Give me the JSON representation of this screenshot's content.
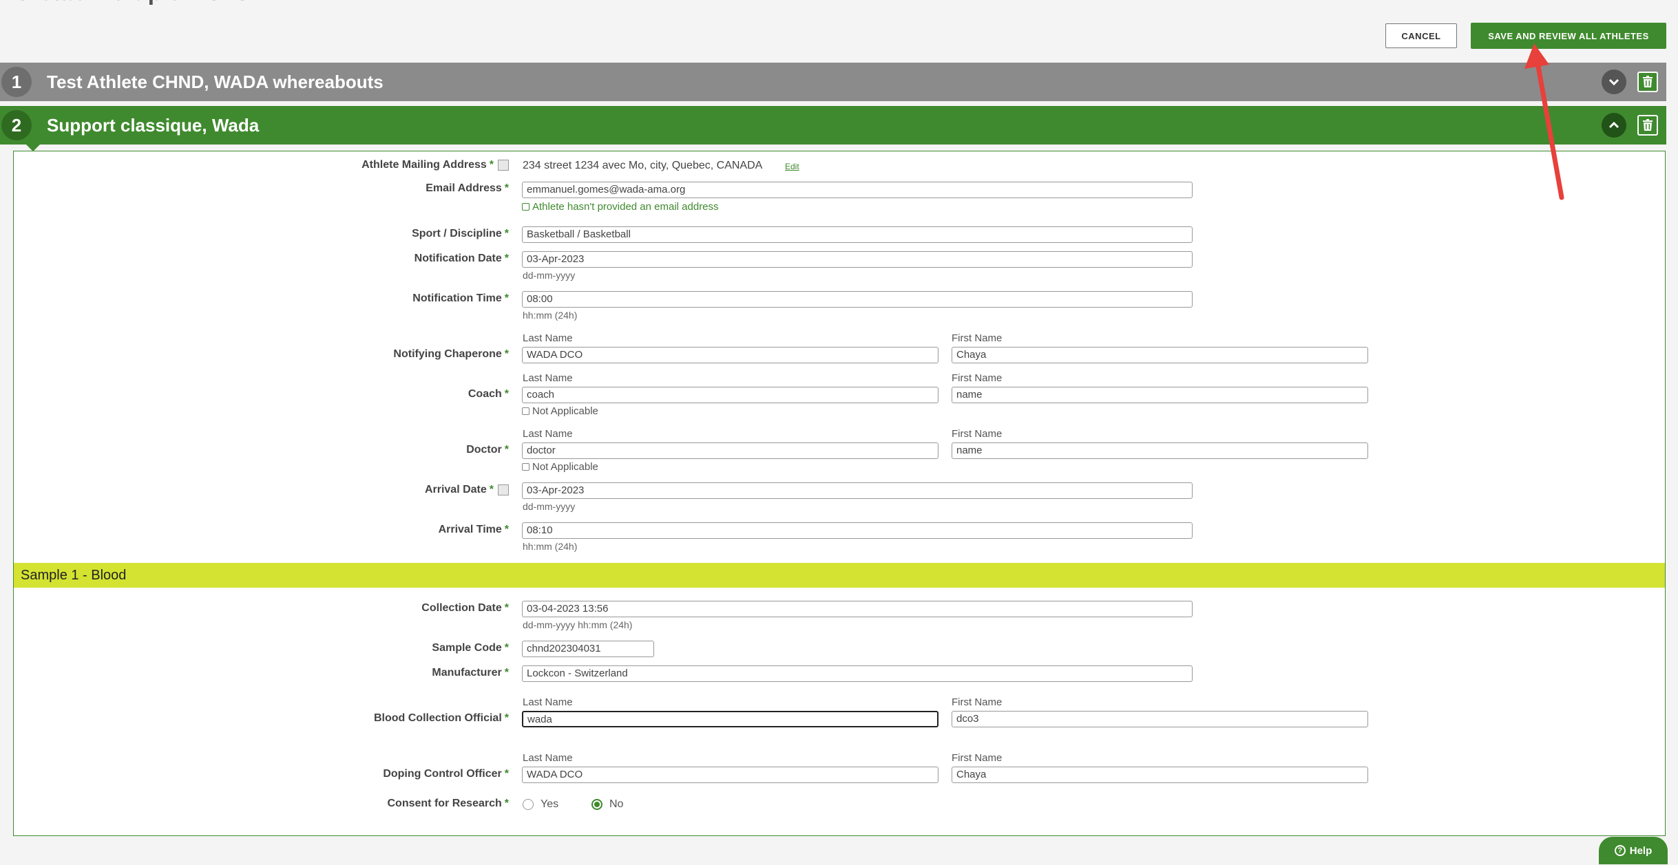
{
  "page": {
    "title": "Create Multiple DCFs"
  },
  "toolbar": {
    "cancel_label": "CANCEL",
    "save_label": "SAVE AND REVIEW ALL ATHLETES"
  },
  "athletes": [
    {
      "number": "1",
      "name": "Test Athlete CHND, WADA whereabouts"
    },
    {
      "number": "2",
      "name": "Support classique, Wada"
    }
  ],
  "form": {
    "mailing_address": {
      "label": "Athlete Mailing Address",
      "value": "234 street 1234 avec Mo, city, Quebec, CANADA",
      "edit": "Edit"
    },
    "email": {
      "label": "Email Address",
      "value": "emmanuel.gomes@wada-ama.org",
      "checkbox": "Athlete hasn't provided an email address"
    },
    "sport": {
      "label": "Sport / Discipline",
      "value": "Basketball / Basketball"
    },
    "notification_date": {
      "label": "Notification Date",
      "value": "03-Apr-2023",
      "hint": "dd-mm-yyyy"
    },
    "notification_time": {
      "label": "Notification Time",
      "value": "08:00",
      "hint": "hh:mm (24h)"
    },
    "chaperone": {
      "label": "Notifying Chaperone",
      "last_label": "Last Name",
      "first_label": "First Name",
      "last": "WADA DCO",
      "first": "Chaya"
    },
    "coach": {
      "label": "Coach",
      "last_label": "Last Name",
      "first_label": "First Name",
      "last": "coach",
      "first": "name",
      "checkbox": "Not Applicable"
    },
    "doctor": {
      "label": "Doctor",
      "last_label": "Last Name",
      "first_label": "First Name",
      "last": "doctor",
      "first": "name",
      "checkbox": "Not Applicable"
    },
    "arrival_date": {
      "label": "Arrival Date",
      "value": "03-Apr-2023",
      "hint": "dd-mm-yyyy"
    },
    "arrival_time": {
      "label": "Arrival Time",
      "value": "08:10",
      "hint": "hh:mm (24h)"
    }
  },
  "sample": {
    "header": "Sample 1 - Blood",
    "collection_date": {
      "label": "Collection Date",
      "value": "03-04-2023 13:56",
      "hint": "dd-mm-yyyy hh:mm (24h)"
    },
    "sample_code": {
      "label": "Sample Code",
      "value": "chnd202304031"
    },
    "manufacturer": {
      "label": "Manufacturer",
      "value": "Lockcon - Switzerland"
    },
    "bco": {
      "label": "Blood Collection Official",
      "last_label": "Last Name",
      "first_label": "First Name",
      "last": "wada",
      "first": "dco3"
    },
    "dco": {
      "label": "Doping Control Officer",
      "last_label": "Last Name",
      "first_label": "First Name",
      "last": "WADA DCO",
      "first": "Chaya"
    },
    "consent": {
      "label": "Consent for Research",
      "yes": "Yes",
      "no": "No",
      "selected": "No"
    }
  },
  "help": {
    "label": "Help"
  },
  "required_marker": "*",
  "colors": {
    "primary_green": "#3f8a2e",
    "grey_bar": "#8b8b8b",
    "sample_bar": "#d4e331",
    "annotation_arrow": "#e8403a"
  }
}
